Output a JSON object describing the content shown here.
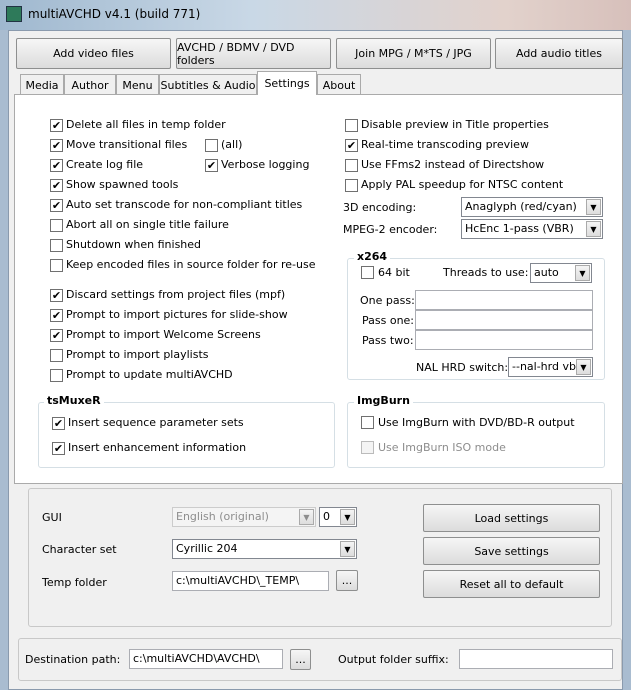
{
  "window": {
    "title": "multiAVCHD v4.1 (build 771)"
  },
  "toolbar": {
    "add_video": "Add video files",
    "folders": "AVCHD / BDMV / DVD folders",
    "join": "Join MPG / M*TS / JPG",
    "add_audio": "Add audio titles"
  },
  "tabs": [
    "Media",
    "Author",
    "Menu",
    "Subtitles & Audio",
    "Settings",
    "About"
  ],
  "active_tab": "Settings",
  "left_options": [
    {
      "label": "Delete all files in temp folder",
      "checked": true
    },
    {
      "label": "Move transitional files",
      "checked": true
    },
    {
      "label": "Create log file",
      "checked": true
    },
    {
      "label": "Show spawned tools",
      "checked": true
    },
    {
      "label": "Auto set transcode for non-compliant titles",
      "checked": true
    },
    {
      "label": "Abort all on single title failure",
      "checked": false
    },
    {
      "label": "Shutdown when finished",
      "checked": false
    },
    {
      "label": "Keep encoded files in source folder for re-use",
      "checked": false
    },
    {
      "label": "Discard settings from project files (mpf)",
      "checked": true
    },
    {
      "label": "Prompt to import pictures for slide-show",
      "checked": true
    },
    {
      "label": "Prompt to import Welcome Screens",
      "checked": true
    },
    {
      "label": "Prompt to import playlists",
      "checked": false
    },
    {
      "label": "Prompt to update multiAVCHD",
      "checked": false
    }
  ],
  "all_option": {
    "label": "(all)",
    "checked": false
  },
  "verbose_option": {
    "label": "Verbose logging",
    "checked": true
  },
  "right_options": [
    {
      "label": "Disable preview in Title properties",
      "checked": false
    },
    {
      "label": "Real-time transcoding preview",
      "checked": true
    },
    {
      "label": "Use FFms2 instead of Directshow",
      "checked": false
    },
    {
      "label": "Apply PAL speedup for NTSC content",
      "checked": false
    }
  ],
  "encoding_3d": {
    "label": "3D encoding:",
    "value": "Anaglyph (red/cyan)"
  },
  "mpeg2": {
    "label": "MPEG-2 encoder:",
    "value": "HcEnc 1-pass (VBR)"
  },
  "x264": {
    "title": "x264",
    "bit64": {
      "label": "64 bit",
      "checked": false
    },
    "threads_label": "Threads to use:",
    "threads_value": "auto",
    "one_pass": "One pass:",
    "pass_one": "Pass one:",
    "pass_two": "Pass two:",
    "nal_label": "NAL HRD switch:",
    "nal_value": "--nal-hrd vbr"
  },
  "tsmuxer": {
    "title": "tsMuxeR",
    "options": [
      {
        "label": "Insert sequence parameter sets",
        "checked": true
      },
      {
        "label": "Insert enhancement information",
        "checked": true
      }
    ]
  },
  "imgburn": {
    "title": "ImgBurn",
    "use": {
      "label": "Use ImgBurn with DVD/BD-R output",
      "checked": false
    },
    "iso": {
      "label": "Use ImgBurn ISO mode",
      "checked": false
    }
  },
  "general": {
    "gui_label": "GUI",
    "gui_value": "English (original)",
    "gui_num": "0",
    "charset_label": "Character set",
    "charset_value": "Cyrillic 204",
    "temp_label": "Temp folder",
    "temp_value": "c:\\multiAVCHD\\_TEMP\\",
    "browse": "...",
    "load": "Load settings",
    "save": "Save settings",
    "reset": "Reset all to default"
  },
  "destination": {
    "label": "Destination path:",
    "value": "c:\\multiAVCHD\\AVCHD\\",
    "browse": "...",
    "suffix_label": "Output folder suffix:",
    "suffix_value": ""
  }
}
